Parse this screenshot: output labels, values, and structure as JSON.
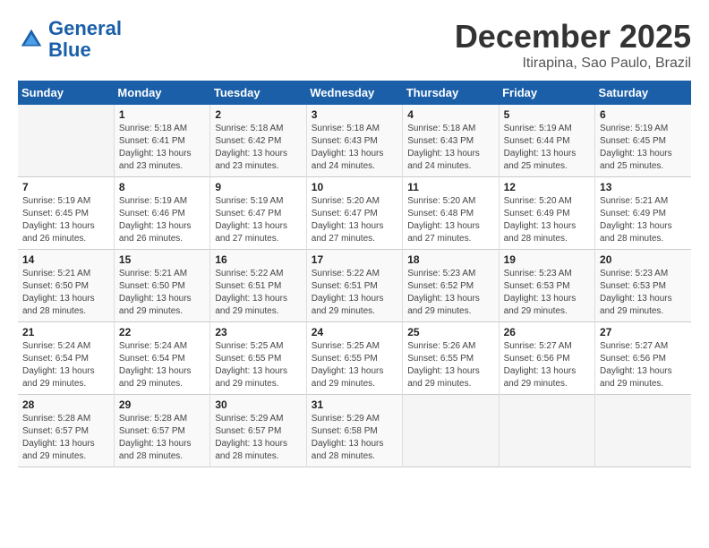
{
  "header": {
    "logo_line1": "General",
    "logo_line2": "Blue",
    "month": "December 2025",
    "location": "Itirapina, Sao Paulo, Brazil"
  },
  "weekdays": [
    "Sunday",
    "Monday",
    "Tuesday",
    "Wednesday",
    "Thursday",
    "Friday",
    "Saturday"
  ],
  "weeks": [
    [
      {
        "day": "",
        "info": ""
      },
      {
        "day": "1",
        "info": "Sunrise: 5:18 AM\nSunset: 6:41 PM\nDaylight: 13 hours\nand 23 minutes."
      },
      {
        "day": "2",
        "info": "Sunrise: 5:18 AM\nSunset: 6:42 PM\nDaylight: 13 hours\nand 23 minutes."
      },
      {
        "day": "3",
        "info": "Sunrise: 5:18 AM\nSunset: 6:43 PM\nDaylight: 13 hours\nand 24 minutes."
      },
      {
        "day": "4",
        "info": "Sunrise: 5:18 AM\nSunset: 6:43 PM\nDaylight: 13 hours\nand 24 minutes."
      },
      {
        "day": "5",
        "info": "Sunrise: 5:19 AM\nSunset: 6:44 PM\nDaylight: 13 hours\nand 25 minutes."
      },
      {
        "day": "6",
        "info": "Sunrise: 5:19 AM\nSunset: 6:45 PM\nDaylight: 13 hours\nand 25 minutes."
      }
    ],
    [
      {
        "day": "7",
        "info": "Sunrise: 5:19 AM\nSunset: 6:45 PM\nDaylight: 13 hours\nand 26 minutes."
      },
      {
        "day": "8",
        "info": "Sunrise: 5:19 AM\nSunset: 6:46 PM\nDaylight: 13 hours\nand 26 minutes."
      },
      {
        "day": "9",
        "info": "Sunrise: 5:19 AM\nSunset: 6:47 PM\nDaylight: 13 hours\nand 27 minutes."
      },
      {
        "day": "10",
        "info": "Sunrise: 5:20 AM\nSunset: 6:47 PM\nDaylight: 13 hours\nand 27 minutes."
      },
      {
        "day": "11",
        "info": "Sunrise: 5:20 AM\nSunset: 6:48 PM\nDaylight: 13 hours\nand 27 minutes."
      },
      {
        "day": "12",
        "info": "Sunrise: 5:20 AM\nSunset: 6:49 PM\nDaylight: 13 hours\nand 28 minutes."
      },
      {
        "day": "13",
        "info": "Sunrise: 5:21 AM\nSunset: 6:49 PM\nDaylight: 13 hours\nand 28 minutes."
      }
    ],
    [
      {
        "day": "14",
        "info": "Sunrise: 5:21 AM\nSunset: 6:50 PM\nDaylight: 13 hours\nand 28 minutes."
      },
      {
        "day": "15",
        "info": "Sunrise: 5:21 AM\nSunset: 6:50 PM\nDaylight: 13 hours\nand 29 minutes."
      },
      {
        "day": "16",
        "info": "Sunrise: 5:22 AM\nSunset: 6:51 PM\nDaylight: 13 hours\nand 29 minutes."
      },
      {
        "day": "17",
        "info": "Sunrise: 5:22 AM\nSunset: 6:51 PM\nDaylight: 13 hours\nand 29 minutes."
      },
      {
        "day": "18",
        "info": "Sunrise: 5:23 AM\nSunset: 6:52 PM\nDaylight: 13 hours\nand 29 minutes."
      },
      {
        "day": "19",
        "info": "Sunrise: 5:23 AM\nSunset: 6:53 PM\nDaylight: 13 hours\nand 29 minutes."
      },
      {
        "day": "20",
        "info": "Sunrise: 5:23 AM\nSunset: 6:53 PM\nDaylight: 13 hours\nand 29 minutes."
      }
    ],
    [
      {
        "day": "21",
        "info": "Sunrise: 5:24 AM\nSunset: 6:54 PM\nDaylight: 13 hours\nand 29 minutes."
      },
      {
        "day": "22",
        "info": "Sunrise: 5:24 AM\nSunset: 6:54 PM\nDaylight: 13 hours\nand 29 minutes."
      },
      {
        "day": "23",
        "info": "Sunrise: 5:25 AM\nSunset: 6:55 PM\nDaylight: 13 hours\nand 29 minutes."
      },
      {
        "day": "24",
        "info": "Sunrise: 5:25 AM\nSunset: 6:55 PM\nDaylight: 13 hours\nand 29 minutes."
      },
      {
        "day": "25",
        "info": "Sunrise: 5:26 AM\nSunset: 6:55 PM\nDaylight: 13 hours\nand 29 minutes."
      },
      {
        "day": "26",
        "info": "Sunrise: 5:27 AM\nSunset: 6:56 PM\nDaylight: 13 hours\nand 29 minutes."
      },
      {
        "day": "27",
        "info": "Sunrise: 5:27 AM\nSunset: 6:56 PM\nDaylight: 13 hours\nand 29 minutes."
      }
    ],
    [
      {
        "day": "28",
        "info": "Sunrise: 5:28 AM\nSunset: 6:57 PM\nDaylight: 13 hours\nand 29 minutes."
      },
      {
        "day": "29",
        "info": "Sunrise: 5:28 AM\nSunset: 6:57 PM\nDaylight: 13 hours\nand 28 minutes."
      },
      {
        "day": "30",
        "info": "Sunrise: 5:29 AM\nSunset: 6:57 PM\nDaylight: 13 hours\nand 28 minutes."
      },
      {
        "day": "31",
        "info": "Sunrise: 5:29 AM\nSunset: 6:58 PM\nDaylight: 13 hours\nand 28 minutes."
      },
      {
        "day": "",
        "info": ""
      },
      {
        "day": "",
        "info": ""
      },
      {
        "day": "",
        "info": ""
      }
    ]
  ]
}
